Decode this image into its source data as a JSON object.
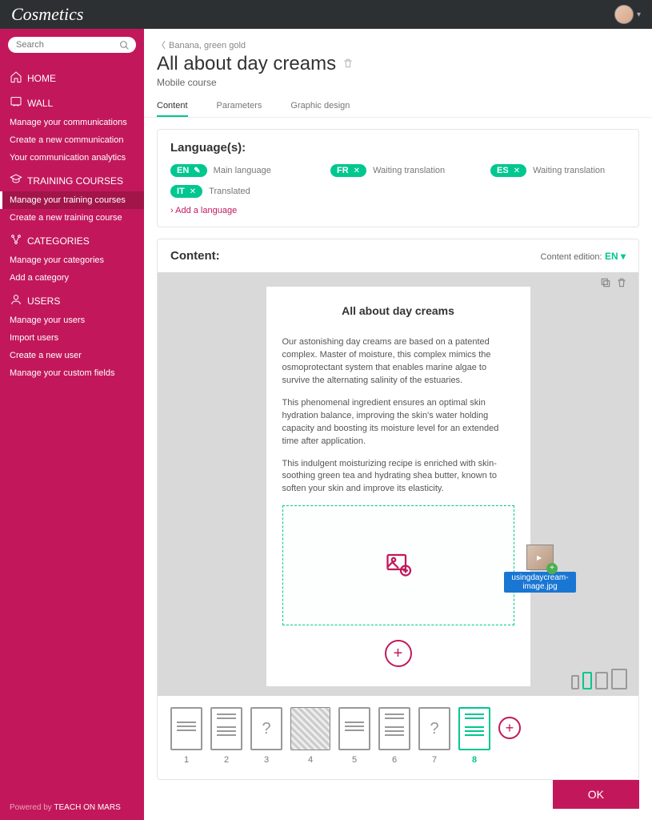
{
  "header": {
    "brand": "Cosmetics"
  },
  "sidebar": {
    "search_placeholder": "Search",
    "home": "HOME",
    "wall": {
      "title": "WALL",
      "items": [
        "Manage your communications",
        "Create a new communication",
        "Your communication analytics"
      ]
    },
    "training": {
      "title": "TRAINING COURSES",
      "items": [
        "Manage your training courses",
        "Create a new training course"
      ],
      "active_index": 0
    },
    "categories": {
      "title": "CATEGORIES",
      "items": [
        "Manage your categories",
        "Add a category"
      ]
    },
    "users": {
      "title": "USERS",
      "items": [
        "Manage your users",
        "Import users",
        "Create a new user",
        "Manage your custom fields"
      ]
    },
    "footer_prefix": "Powered by ",
    "footer_brand": "TEACH ON MARS"
  },
  "breadcrumb": "Banana, green gold",
  "page_title": "All about day creams",
  "page_subtitle": "Mobile course",
  "tabs": [
    "Content",
    "Parameters",
    "Graphic design"
  ],
  "languages_heading": "Language(s):",
  "languages": [
    {
      "code": "EN",
      "label": "Main language",
      "editable": true
    },
    {
      "code": "FR",
      "label": "Waiting translation",
      "removable": true
    },
    {
      "code": "ES",
      "label": "Waiting translation",
      "removable": true
    },
    {
      "code": "IT",
      "label": "Translated",
      "removable": true
    }
  ],
  "add_language": "Add a language",
  "content_heading": "Content:",
  "content_edition_label": "Content edition:",
  "content_edition_value": "EN",
  "card": {
    "title": "All about day creams",
    "paragraphs": [
      "Our astonishing day creams are based on a patented complex. Master of moisture, this complex mimics the osmoprotectant system that enables marine algae to survive the alternating salinity of the estuaries.",
      "This phenomenal ingredient ensures an optimal skin hydration balance, improving the skin's water holding capacity and boosting its moisture level for an extended time after application.",
      "This indulgent moisturizing recipe is enriched with skin-soothing green tea and hydrating shea butter, known to soften your skin and improve its elasticity."
    ]
  },
  "drag_file_name": "usingdaycream-image.jpg",
  "pages": {
    "count": 8,
    "active": 8
  },
  "ok_label": "OK",
  "colors": {
    "primary": "#c2185b",
    "accent": "#00c78f"
  }
}
